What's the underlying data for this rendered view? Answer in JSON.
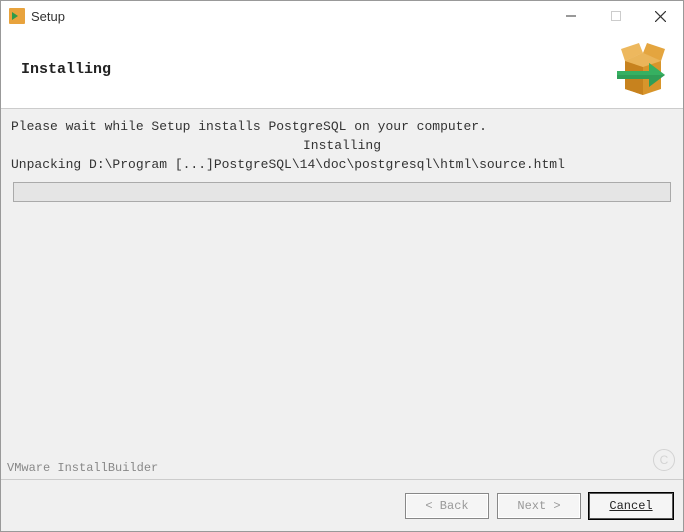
{
  "window": {
    "title": "Setup"
  },
  "header": {
    "title": "Installing"
  },
  "content": {
    "wait_text": "Please wait while Setup installs PostgreSQL on your computer.",
    "status": "Installing",
    "unpack_text": "Unpacking D:\\Program [...]PostgreSQL\\14\\doc\\postgresql\\html\\source.html"
  },
  "footer": {
    "brand": "VMware InstallBuilder",
    "back_label": "< Back",
    "next_label": "Next >",
    "cancel_label": "Cancel"
  }
}
